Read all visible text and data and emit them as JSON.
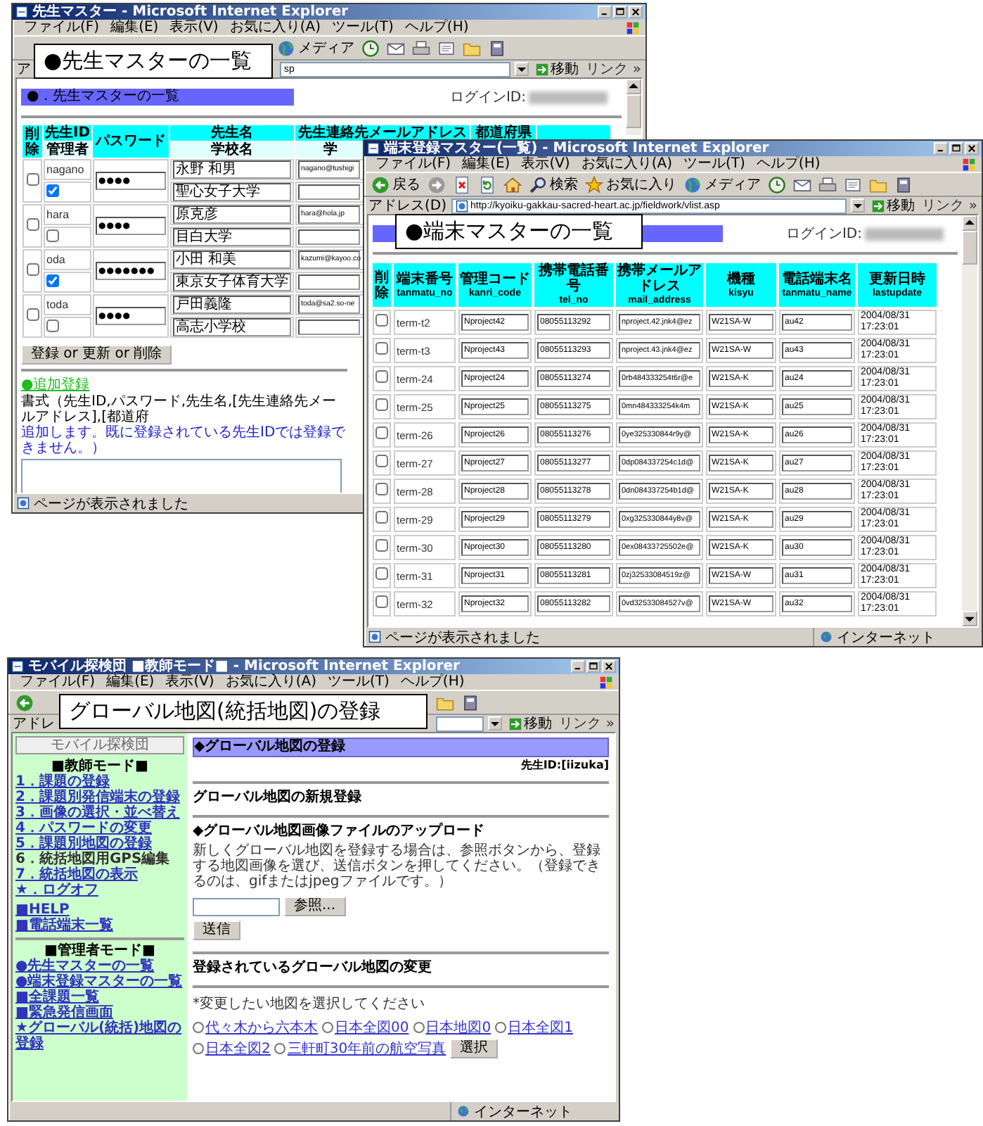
{
  "windows": [
    {
      "kind": "teacher_list",
      "title": "先生マスター - Microsoft Internet Explorer",
      "menu": [
        "ファイル(F)",
        "編集(E)",
        "表示(V)",
        "お気に入り(A)",
        "ツール(T)",
        "ヘルプ(H)"
      ],
      "toolbar_labels": [
        "メディア"
      ],
      "address_label": "ア",
      "address": "sp",
      "go": "移動",
      "links": "リンク »",
      "header": "●．先生マスターの一覧",
      "login_label": "ログインID:",
      "columns_top": [
        "削除",
        "先生ID",
        "パスワード",
        "先生名",
        "先生連絡先メールアドレス",
        "都道府県"
      ],
      "columns_sub": [
        "管理者",
        "学校名",
        "学"
      ],
      "rows": [
        {
          "delete": false,
          "id": "nagano",
          "admin": true,
          "password": "●●●●",
          "name": "永野 和男",
          "school": "聖心女子大学",
          "email": "nagano@tushigi"
        },
        {
          "delete": false,
          "id": "hara",
          "admin": false,
          "password": "●●●●",
          "name": "原克彦",
          "school": "目白大学",
          "email": "hara@hola.jp"
        },
        {
          "delete": false,
          "id": "oda",
          "admin": true,
          "password": "●●●●●●●",
          "name": "小田 和美",
          "school": "東京女子体育大学",
          "email": "kazumi@kayoo.co"
        },
        {
          "delete": false,
          "id": "toda",
          "admin": false,
          "password": "●●●●",
          "name": "戸田義隆",
          "school": "高志小学校",
          "email": "toda@sa2.so-ne"
        }
      ],
      "submit": "登録 or 更新 or 削除",
      "add_link": "●追加登録",
      "format": "書式（先生ID,パスワード,先生名,[先生連絡先メールアドレス],[都道府",
      "note": "追加します。既に登録されている先生IDでは登録できません。）",
      "status": {
        "text": "ページが表示されました"
      }
    },
    {
      "kind": "terminal_list",
      "title": "端末登録マスター(一覧) - Microsoft Internet Explorer",
      "menu": [
        "ファイル(F)",
        "編集(E)",
        "表示(V)",
        "お気に入り(A)",
        "ツール(T)",
        "ヘルプ(H)"
      ],
      "toolbar_labels": [
        "戻る",
        "検索",
        "お気に入り",
        "メディア"
      ],
      "address_label": "アドレス(D)",
      "address": "http://kyoiku-gakkau-sacred-heart.ac.jp/fieldwork/vlist.asp",
      "go": "移動",
      "links": "リンク »",
      "login_label": "ログインID:",
      "columns": [
        {
          "label": "削除"
        },
        {
          "label": "端末番号",
          "field": "tanmatu_no"
        },
        {
          "label": "管理コード",
          "field": "kanri_code"
        },
        {
          "label": "携帯電話番号",
          "field": "tel_no"
        },
        {
          "label": "携帯メールアドレス",
          "field": "mail_address"
        },
        {
          "label": "機種",
          "field": "kisyu"
        },
        {
          "label": "電話端末名",
          "field": "tanmatu_name"
        },
        {
          "label": "更新日時",
          "field": "lastupdate"
        }
      ],
      "rows": [
        {
          "delete": false,
          "terminal": "term-t2",
          "code": "Nproject42",
          "tel": "08055113292",
          "mail": "nproject.42.jnk4@ez",
          "model": "W21SA-W",
          "device": "au42",
          "updated": "2004/08/31 17:23:01"
        },
        {
          "delete": false,
          "terminal": "term-t3",
          "code": "Nproject43",
          "tel": "08055113293",
          "mail": "nproject.43.jnk4@ez",
          "model": "W21SA-W",
          "device": "au43",
          "updated": "2004/08/31 17:23:01"
        },
        {
          "delete": false,
          "terminal": "term-24",
          "code": "Nproject24",
          "tel": "08055113274",
          "mail": "0rb484333254t6r@e",
          "model": "W21SA-K",
          "device": "au24",
          "updated": "2004/08/31 17:23:01"
        },
        {
          "delete": false,
          "terminal": "term-25",
          "code": "Nproject25",
          "tel": "08055113275",
          "mail": "0mn484333254k4m",
          "model": "W21SA-K",
          "device": "au25",
          "updated": "2004/08/31 17:23:01"
        },
        {
          "delete": false,
          "terminal": "term-26",
          "code": "Nproject26",
          "tel": "08055113276",
          "mail": "0ye325330844r9y@",
          "model": "W21SA-K",
          "device": "au26",
          "updated": "2004/08/31 17:23:01"
        },
        {
          "delete": false,
          "terminal": "term-27",
          "code": "Nproject27",
          "tel": "08055113277",
          "mail": "0dp084337254c1d@",
          "model": "W21SA-K",
          "device": "au27",
          "updated": "2004/08/31 17:23:01"
        },
        {
          "delete": false,
          "terminal": "term-28",
          "code": "Nproject28",
          "tel": "08055113278",
          "mail": "0dn084337254b1d@",
          "model": "W21SA-K",
          "device": "au28",
          "updated": "2004/08/31 17:23:01"
        },
        {
          "delete": false,
          "terminal": "term-29",
          "code": "Nproject29",
          "tel": "08055113279",
          "mail": "0xg325330844y8v@",
          "model": "W21SA-K",
          "device": "au29",
          "updated": "2004/08/31 17:23:01"
        },
        {
          "delete": false,
          "terminal": "term-30",
          "code": "Nproject30",
          "tel": "08055113280",
          "mail": "0ex08433725502e@",
          "model": "W21SA-K",
          "device": "au30",
          "updated": "2004/08/31 17:23:01"
        },
        {
          "delete": false,
          "terminal": "term-31",
          "code": "Nproject31",
          "tel": "08055113281",
          "mail": "0zj32533084519z@",
          "model": "W21SA-W",
          "device": "au31",
          "updated": "2004/08/31 17:23:01"
        },
        {
          "delete": false,
          "terminal": "term-32",
          "code": "Nproject32",
          "tel": "08055113282",
          "mail": "0vd32533084527v@",
          "model": "W21SA-W",
          "device": "au32",
          "updated": "2004/08/31 17:23:01"
        }
      ],
      "status": {
        "text": "ページが表示されました",
        "zone": "インターネット"
      }
    },
    {
      "kind": "map_register",
      "title": "モバイル探検団 ■教師モード■ - Microsoft Internet Explorer",
      "menu": [
        "ファイル(F)",
        "編集(E)",
        "表示(V)",
        "お気に入り(A)",
        "ツール(T)",
        "ヘルプ(H)"
      ],
      "address_label": "アドレ",
      "go": "移動",
      "links": "リンク »",
      "sidebar": {
        "button": "モバイル探検団",
        "sections": [
          {
            "heading": "■教師モード■",
            "items": [
              {
                "label": "1．課題の登録",
                "link": true
              },
              {
                "label": "2．課題別発信端末の登録",
                "link": true
              },
              {
                "label": "3．画像の選択・並べ替え",
                "link": true
              },
              {
                "label": "4．パスワードの変更",
                "link": true
              },
              {
                "label": "5．課題別地図の登録",
                "link": true
              },
              {
                "label": "6．統括地図用GPS編集",
                "link": false
              },
              {
                "label": "7．統括地図の表示",
                "link": true
              },
              {
                "label": "★．ログオフ",
                "link": true
              }
            ]
          },
          {
            "items": [
              {
                "label": "■HELP",
                "link": true
              },
              {
                "label": "■電話端末一覧",
                "link": true
              }
            ]
          },
          {
            "heading": "■管理者モード■",
            "items": [
              {
                "label": "●先生マスターの一覧",
                "link": true
              },
              {
                "label": "●端末登録マスターの一覧",
                "link": true
              },
              {
                "label": "■全課題一覧",
                "link": true
              },
              {
                "label": "■緊急発信画面",
                "link": true
              },
              {
                "label": "★グローバル(統括)地図の登録",
                "link": true
              }
            ]
          }
        ]
      },
      "main": {
        "header": "◆グローバル地図の登録",
        "teacher_id": "先生ID:[iizuka]",
        "new_title": "グローバル地図の新規登録",
        "upload_title": "◆グローバル地図画像ファイルのアップロード",
        "description": "新しくグローバル地図を登録する場合は、参照ボタンから、登録する地図画像を選び、送信ボタンを押してください。（登録できるのは、gifまたはjpegファイルです。）",
        "browse": "参照...",
        "send": "送信",
        "change_title": "登録されているグローバル地図の変更",
        "instruction": "*変更したい地図を選択してください",
        "maps": [
          {
            "label": "代々木から六本木",
            "selected": false
          },
          {
            "label": "日本全図00",
            "selected": false
          },
          {
            "label": "日本地図0",
            "selected": false
          },
          {
            "label": "日本全図1",
            "selected": false
          },
          {
            "label": "日本全図2",
            "selected": false
          },
          {
            "label": "三軒町30年前の航空写真",
            "selected": false
          }
        ],
        "select": "選択"
      },
      "status": {
        "zone": "インターネット"
      }
    }
  ],
  "captions": [
    "●先生マスターの一覧",
    "●端末マスターの一覧",
    "グローバル地図(統括地図)の登録"
  ]
}
